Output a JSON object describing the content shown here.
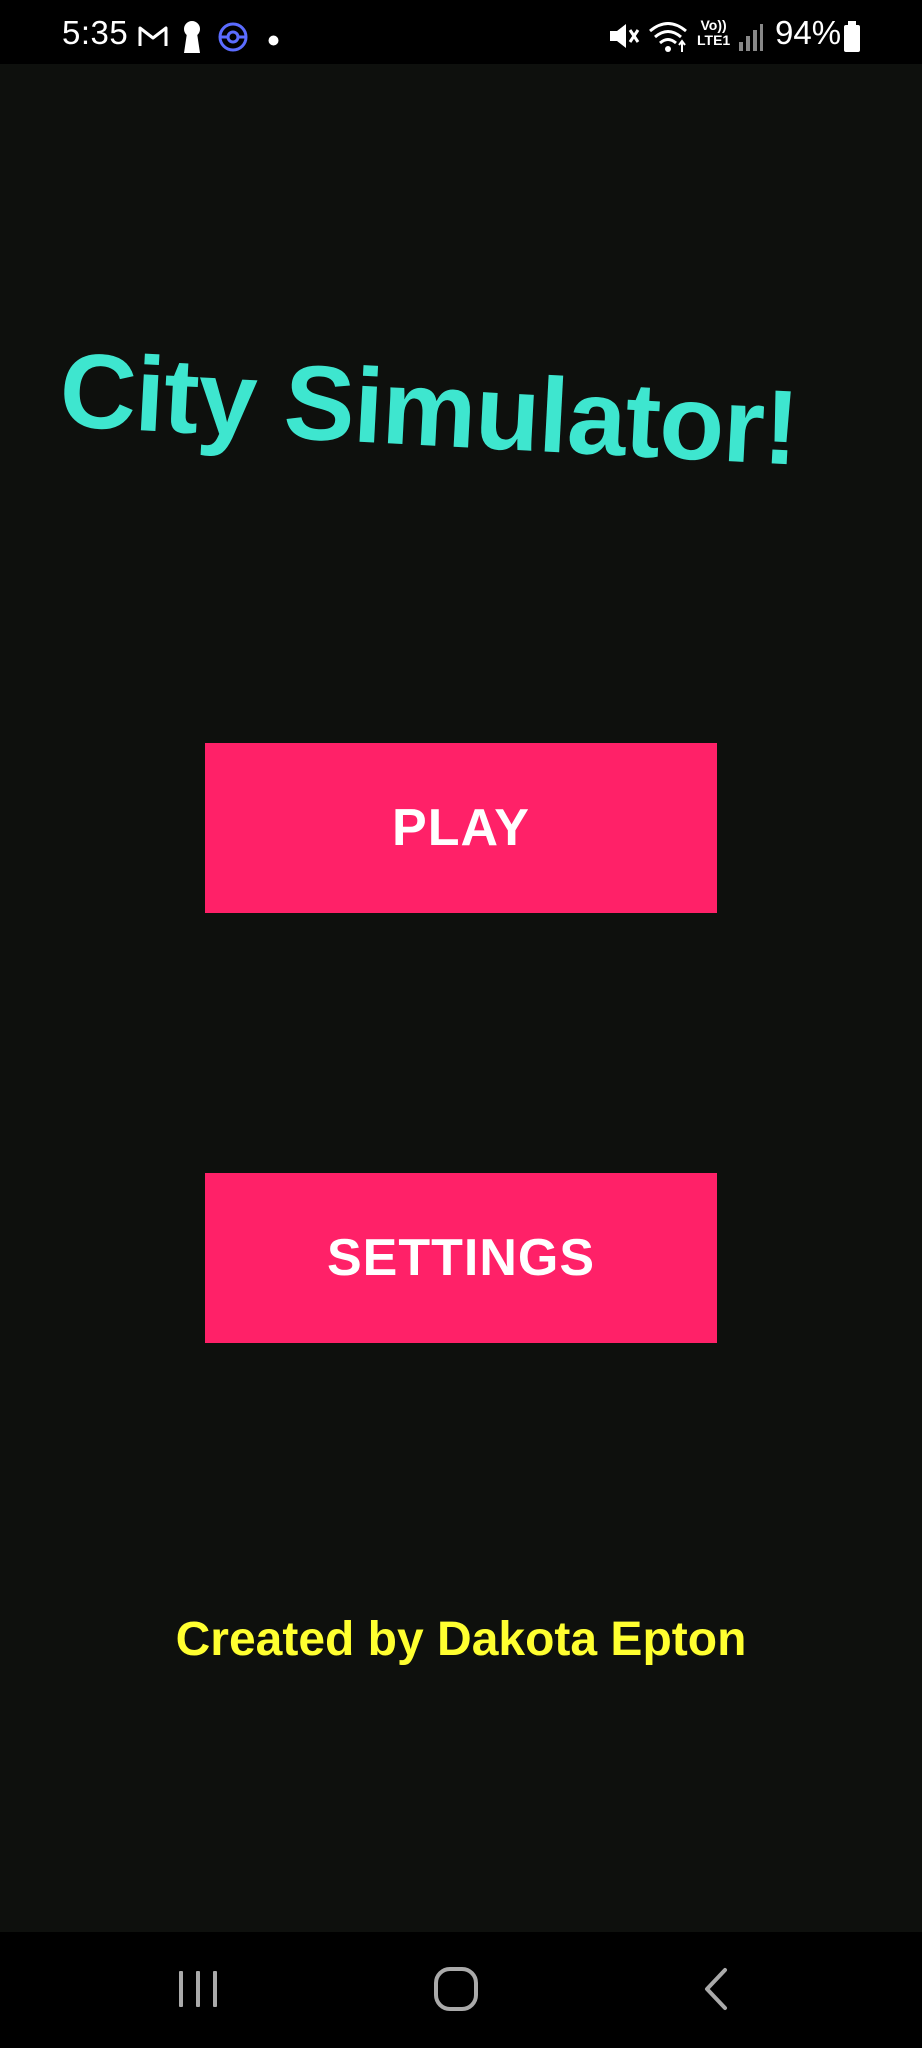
{
  "status_bar": {
    "time": "5:35",
    "battery_percent": "94%",
    "network": "Vo))\nLTE1",
    "icons": [
      "gmail-icon",
      "keyhole-icon",
      "pokeball-icon",
      "notification-dot-icon",
      "mute-icon",
      "wifi-icon",
      "signal-icon",
      "battery-icon"
    ]
  },
  "main": {
    "title": "City Simulator!",
    "play_label": "PLAY",
    "settings_label": "SETTINGS",
    "credit": "Created by Dakota Epton"
  },
  "nav_bar": {
    "buttons": [
      "recents-icon",
      "home-icon",
      "back-icon"
    ]
  },
  "colors": {
    "background": "#0e100d",
    "title": "#3ee6cf",
    "button": "#ff2168",
    "button_text": "#ffffff",
    "credit": "#ffff30"
  }
}
